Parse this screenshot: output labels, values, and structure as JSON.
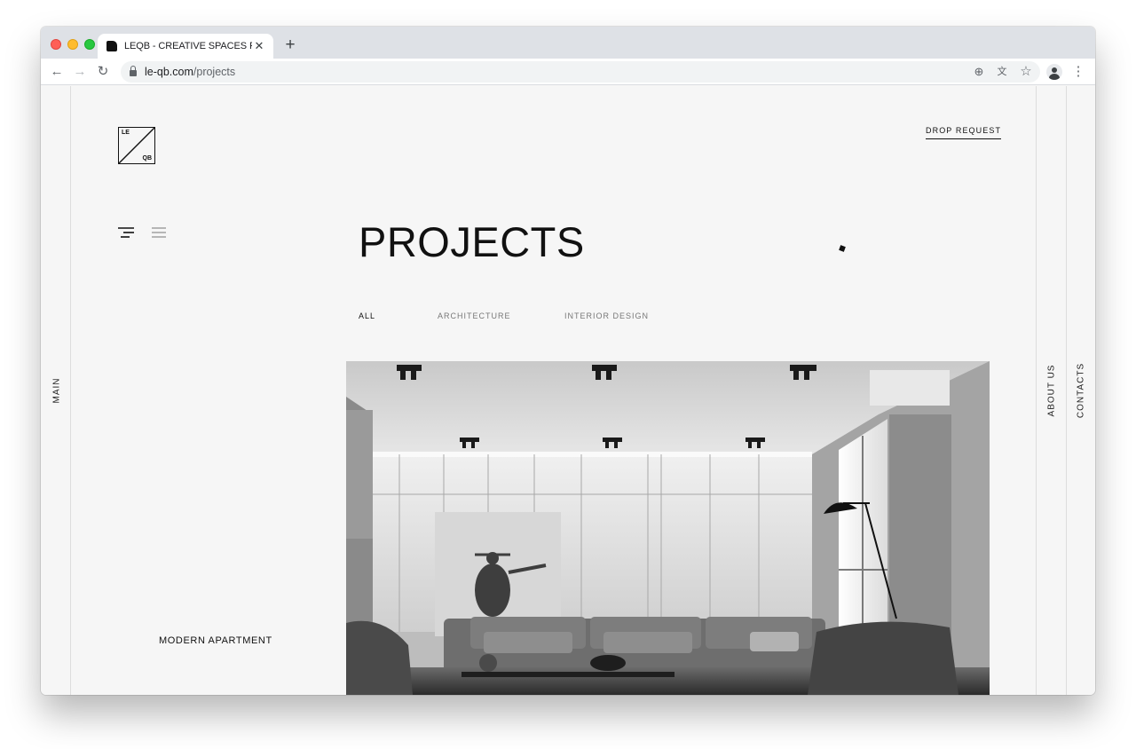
{
  "browser": {
    "tab_title": "LEQB - CREATIVE SPACES FOR",
    "tab_close": "✕",
    "new_tab": "+",
    "url_domain": "le-qb.com",
    "url_path": "/projects",
    "nav_back": "←",
    "nav_forward": "→",
    "nav_reload": "↻",
    "toolbar_icons": {
      "add": "⊕",
      "translate": "文",
      "bookmark": "☆",
      "menu": "⋮"
    }
  },
  "site": {
    "logo_top": "LE",
    "logo_bottom": "QB",
    "drop_request": "DROP REQUEST",
    "page_title": "PROJECTS",
    "filters": [
      "ALL",
      "ARCHITECTURE",
      "INTERIOR DESIGN"
    ],
    "active_filter": "ALL",
    "side_left": "MAIN",
    "side_right_1": "ABOUT US",
    "side_right_2": "CONTACTS",
    "project_name": "MODERN APARTMENT"
  }
}
